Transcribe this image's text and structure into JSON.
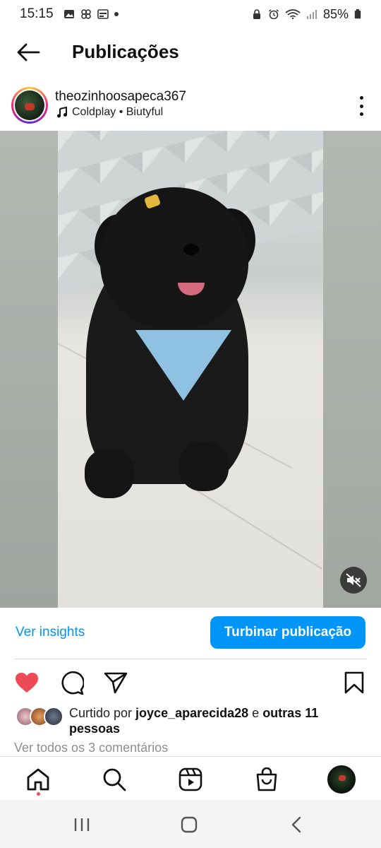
{
  "status_bar": {
    "time": "15:15",
    "battery": "85%"
  },
  "header": {
    "title": "Publicações"
  },
  "post": {
    "username": "theozinhoosapeca367",
    "music": "Coldplay • Biutyful",
    "insights_label": "Ver insights",
    "boost_label": "Turbinar publicação",
    "likes_prefix": "Curtido por ",
    "likes_user": "joyce_aparecida28",
    "likes_middle": " e ",
    "likes_others": "outras 11 pessoas",
    "comments_label": "Ver todos os 3 comentários",
    "liked": true
  },
  "colors": {
    "accent": "#0095f6",
    "like": "#ed4956"
  },
  "icons": {
    "back": "arrow-left-icon",
    "more": "more-vertical-icon",
    "music": "music-note-icon",
    "mute": "speaker-muted-icon",
    "like": "heart-filled-icon",
    "comment": "comment-icon",
    "share": "paper-plane-icon",
    "save": "bookmark-icon",
    "home": "home-icon",
    "search": "search-icon",
    "reels": "reels-icon",
    "shop": "shopping-bag-icon",
    "profile": "profile-avatar"
  }
}
